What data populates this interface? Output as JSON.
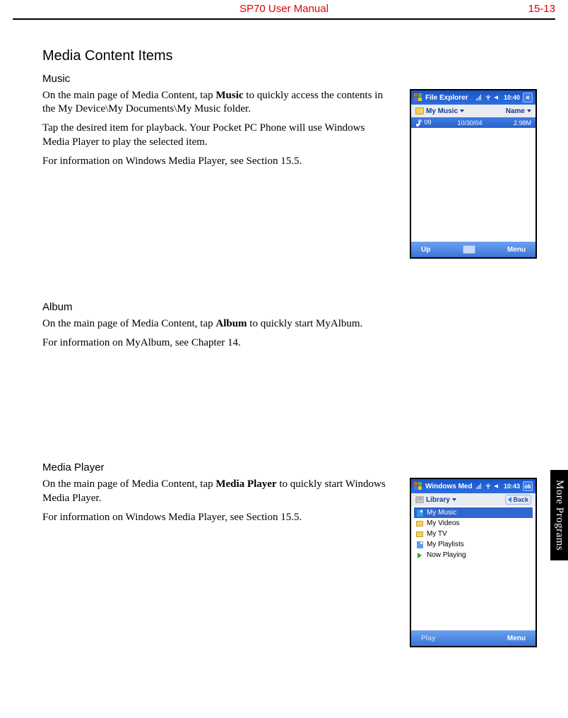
{
  "header": {
    "title": "SP70 User Manual",
    "page": "15-13"
  },
  "side_tab": "More Programs",
  "section_title": "Media Content Items",
  "music": {
    "heading": "Music",
    "p1a": "On the main page of Media Content, tap ",
    "p1b": "Music",
    "p1c": " to quickly access the contents in the My Device\\My Documents\\My Music folder.",
    "p2": "Tap the desired item for playback. Your Pocket PC Phone will use Windows Media Player to play the selected item.",
    "p3": "For information on Windows Media Player, see Section 15.5."
  },
  "album": {
    "heading": "Album",
    "p1a": "On the main page of Media Content, tap ",
    "p1b": "Album",
    "p1c": " to quickly start MyAlbum.",
    "p2": "For information on MyAlbum, see Chapter 14."
  },
  "mediaplayer": {
    "heading": "Media Player",
    "p1a": "On the main page of Media Content, tap ",
    "p1b": "Media Player",
    "p1c": " to quickly start Windows Media Player.",
    "p2": "For information on Windows Media Player, see Section 15.5."
  },
  "shot1": {
    "title": "File Explorer",
    "clock": "10:40",
    "close": "✕",
    "folder_label": "My Music",
    "sort_label": "Name",
    "file_name": "09",
    "file_date": "10/30/04",
    "file_size": "2.98M",
    "soft_left": "Up",
    "soft_right": "Menu"
  },
  "shot2": {
    "title": "Windows Medi",
    "clock": "10:43",
    "ok": "ok",
    "library_label": "Library",
    "back": "Back",
    "items": {
      "0": "My Music",
      "1": "My Videos",
      "2": "My TV",
      "3": "My Playlists",
      "4": "Now Playing"
    },
    "soft_left": "Play",
    "soft_right": "Menu"
  }
}
